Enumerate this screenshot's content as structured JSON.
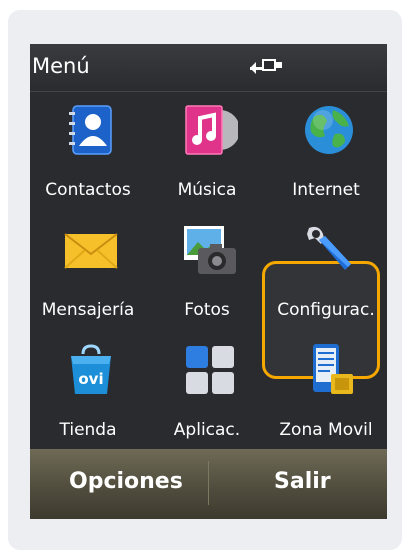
{
  "title": "Menú",
  "status_icon": "usb-connected-icon",
  "items": [
    {
      "label": "Contactos",
      "icon": "contacts-icon"
    },
    {
      "label": "Música",
      "icon": "music-icon"
    },
    {
      "label": "Internet",
      "icon": "globe-icon"
    },
    {
      "label": "Mensajería",
      "icon": "envelope-icon"
    },
    {
      "label": "Fotos",
      "icon": "camera-icon"
    },
    {
      "label": "Configurac.",
      "icon": "wrench-icon",
      "selected": true
    },
    {
      "label": "Tienda",
      "icon": "ovi-bag-icon"
    },
    {
      "label": "Aplicac.",
      "icon": "apps-grid-icon"
    },
    {
      "label": "Zona Movil",
      "icon": "phone-document-icon"
    }
  ],
  "softkeys": {
    "left": "Opciones",
    "right": "Salir"
  },
  "colors": {
    "highlight": "#f5a800",
    "background": "#2a2b2f"
  }
}
